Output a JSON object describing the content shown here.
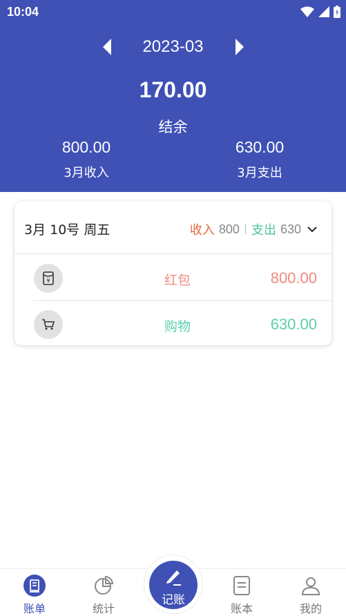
{
  "status_bar": {
    "time": "10:04",
    "icons": [
      "wifi-icon",
      "signal-icon",
      "battery-icon"
    ]
  },
  "header": {
    "month": "2023-03",
    "balance": "170.00",
    "balance_label": "结余",
    "income_value": "800.00",
    "income_label": "3月收入",
    "expense_value": "630.00",
    "expense_label": "3月支出"
  },
  "day_card": {
    "date": "3月 10号 周五",
    "income_label": "收入",
    "income_value": "800",
    "expense_label": "支出",
    "expense_value": "630",
    "entries": [
      {
        "icon": "red-envelope-icon",
        "category": "红包",
        "amount": "800.00",
        "type": "income"
      },
      {
        "icon": "shopping-cart-icon",
        "category": "购物",
        "amount": "630.00",
        "type": "expense"
      }
    ]
  },
  "nav": {
    "items": [
      {
        "label": "账单",
        "icon": "bill-icon",
        "active": true
      },
      {
        "label": "统计",
        "icon": "pie-chart-icon",
        "active": false
      },
      {
        "label": "账本",
        "icon": "ledger-icon",
        "active": false
      },
      {
        "label": "我的",
        "icon": "user-icon",
        "active": false
      }
    ],
    "fab_label": "记账",
    "fab_icon": "pen-icon"
  },
  "colors": {
    "primary": "#3f51b5",
    "income": "#e4693f",
    "income_amount": "#f08a80",
    "expense": "#4fc3a1"
  }
}
